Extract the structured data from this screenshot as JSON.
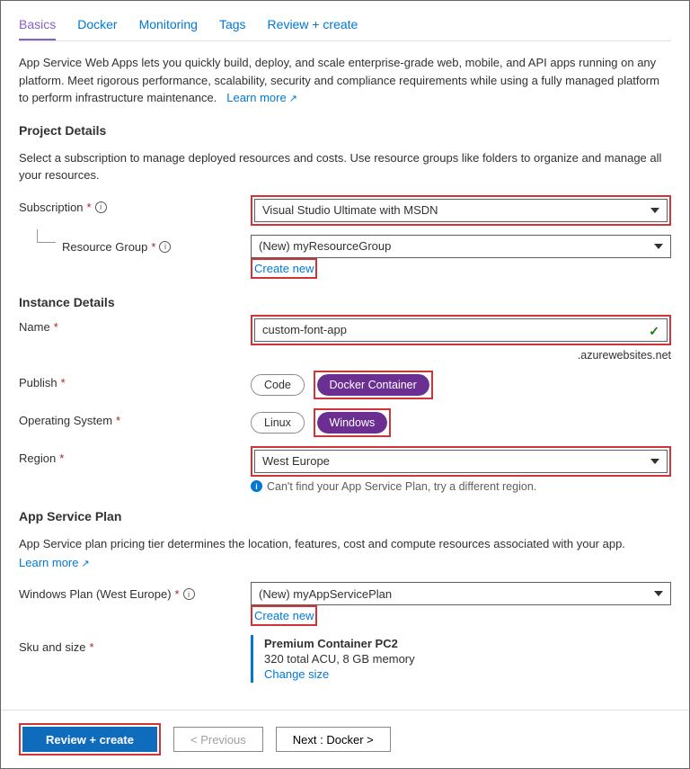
{
  "tabs": {
    "basics": "Basics",
    "docker": "Docker",
    "monitoring": "Monitoring",
    "tags": "Tags",
    "review": "Review + create"
  },
  "intro": {
    "text": "App Service Web Apps lets you quickly build, deploy, and scale enterprise-grade web, mobile, and API apps running on any platform. Meet rigorous performance, scalability, security and compliance requirements while using a fully managed platform to perform infrastructure maintenance.",
    "learn_more": "Learn more"
  },
  "project": {
    "heading": "Project Details",
    "desc": "Select a subscription to manage deployed resources and costs. Use resource groups like folders to organize and manage all your resources.",
    "subscription_label": "Subscription",
    "subscription_value": "Visual Studio Ultimate with MSDN",
    "rg_label": "Resource Group",
    "rg_value": "(New) myResourceGroup",
    "create_new": "Create new"
  },
  "instance": {
    "heading": "Instance Details",
    "name_label": "Name",
    "name_value": "custom-font-app",
    "suffix": ".azurewebsites.net",
    "publish_label": "Publish",
    "publish_code": "Code",
    "publish_docker": "Docker Container",
    "os_label": "Operating System",
    "os_linux": "Linux",
    "os_windows": "Windows",
    "region_label": "Region",
    "region_value": "West Europe",
    "region_hint": "Can't find your App Service Plan, try a different region."
  },
  "plan": {
    "heading": "App Service Plan",
    "desc": "App Service plan pricing tier determines the location, features, cost and compute resources associated with your app.",
    "learn_more": "Learn more",
    "winplan_label": "Windows Plan (West Europe)",
    "winplan_value": "(New) myAppServicePlan",
    "create_new": "Create new",
    "sku_label": "Sku and size",
    "sku_title": "Premium Container PC2",
    "sku_detail": "320 total ACU, 8 GB memory",
    "change_size": "Change size"
  },
  "footer": {
    "review": "Review + create",
    "previous": "< Previous",
    "next": "Next : Docker >"
  }
}
